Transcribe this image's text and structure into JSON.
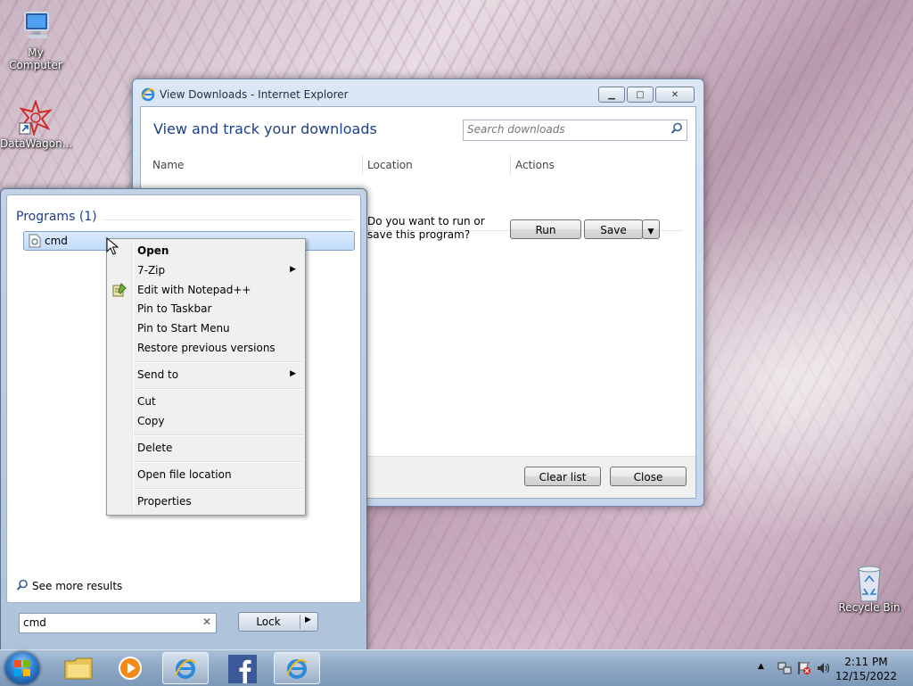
{
  "desktop": {
    "icons": [
      {
        "label": "My Computer"
      },
      {
        "label": "DataWagon..."
      },
      {
        "label": "Recycle Bin"
      }
    ]
  },
  "ie_window": {
    "title": "View Downloads - Internet Explorer",
    "heading": "View and track your downloads",
    "search_placeholder": "Search downloads",
    "columns": {
      "name": "Name",
      "location": "Location",
      "actions": "Actions"
    },
    "download_prompt": "Do you want to run or save this program?",
    "run_label": "Run",
    "save_label": "Save",
    "clear_list_label": "Clear list",
    "close_label": "Close"
  },
  "start_menu": {
    "programs_header": "Programs (1)",
    "result": "cmd",
    "see_more": "See more results",
    "search_value": "cmd",
    "lock_label": "Lock"
  },
  "context_menu": {
    "items": [
      {
        "label": "Open"
      },
      {
        "label": "7-Zip"
      },
      {
        "label": "Edit with Notepad++"
      },
      {
        "label": "Pin to Taskbar"
      },
      {
        "label": "Pin to Start Menu"
      },
      {
        "label": "Restore previous versions"
      },
      {
        "label": "Send to"
      },
      {
        "label": "Cut"
      },
      {
        "label": "Copy"
      },
      {
        "label": "Delete"
      },
      {
        "label": "Open file location"
      },
      {
        "label": "Properties"
      }
    ]
  },
  "taskbar": {
    "time": "2:11 PM",
    "date": "12/15/2022",
    "items": [
      "windows-explorer",
      "media-player",
      "internet-explorer",
      "facebook",
      "internet-explorer"
    ]
  },
  "colors": {
    "heading_blue": "#1e3f8a",
    "selection": "#c1dcfc"
  }
}
